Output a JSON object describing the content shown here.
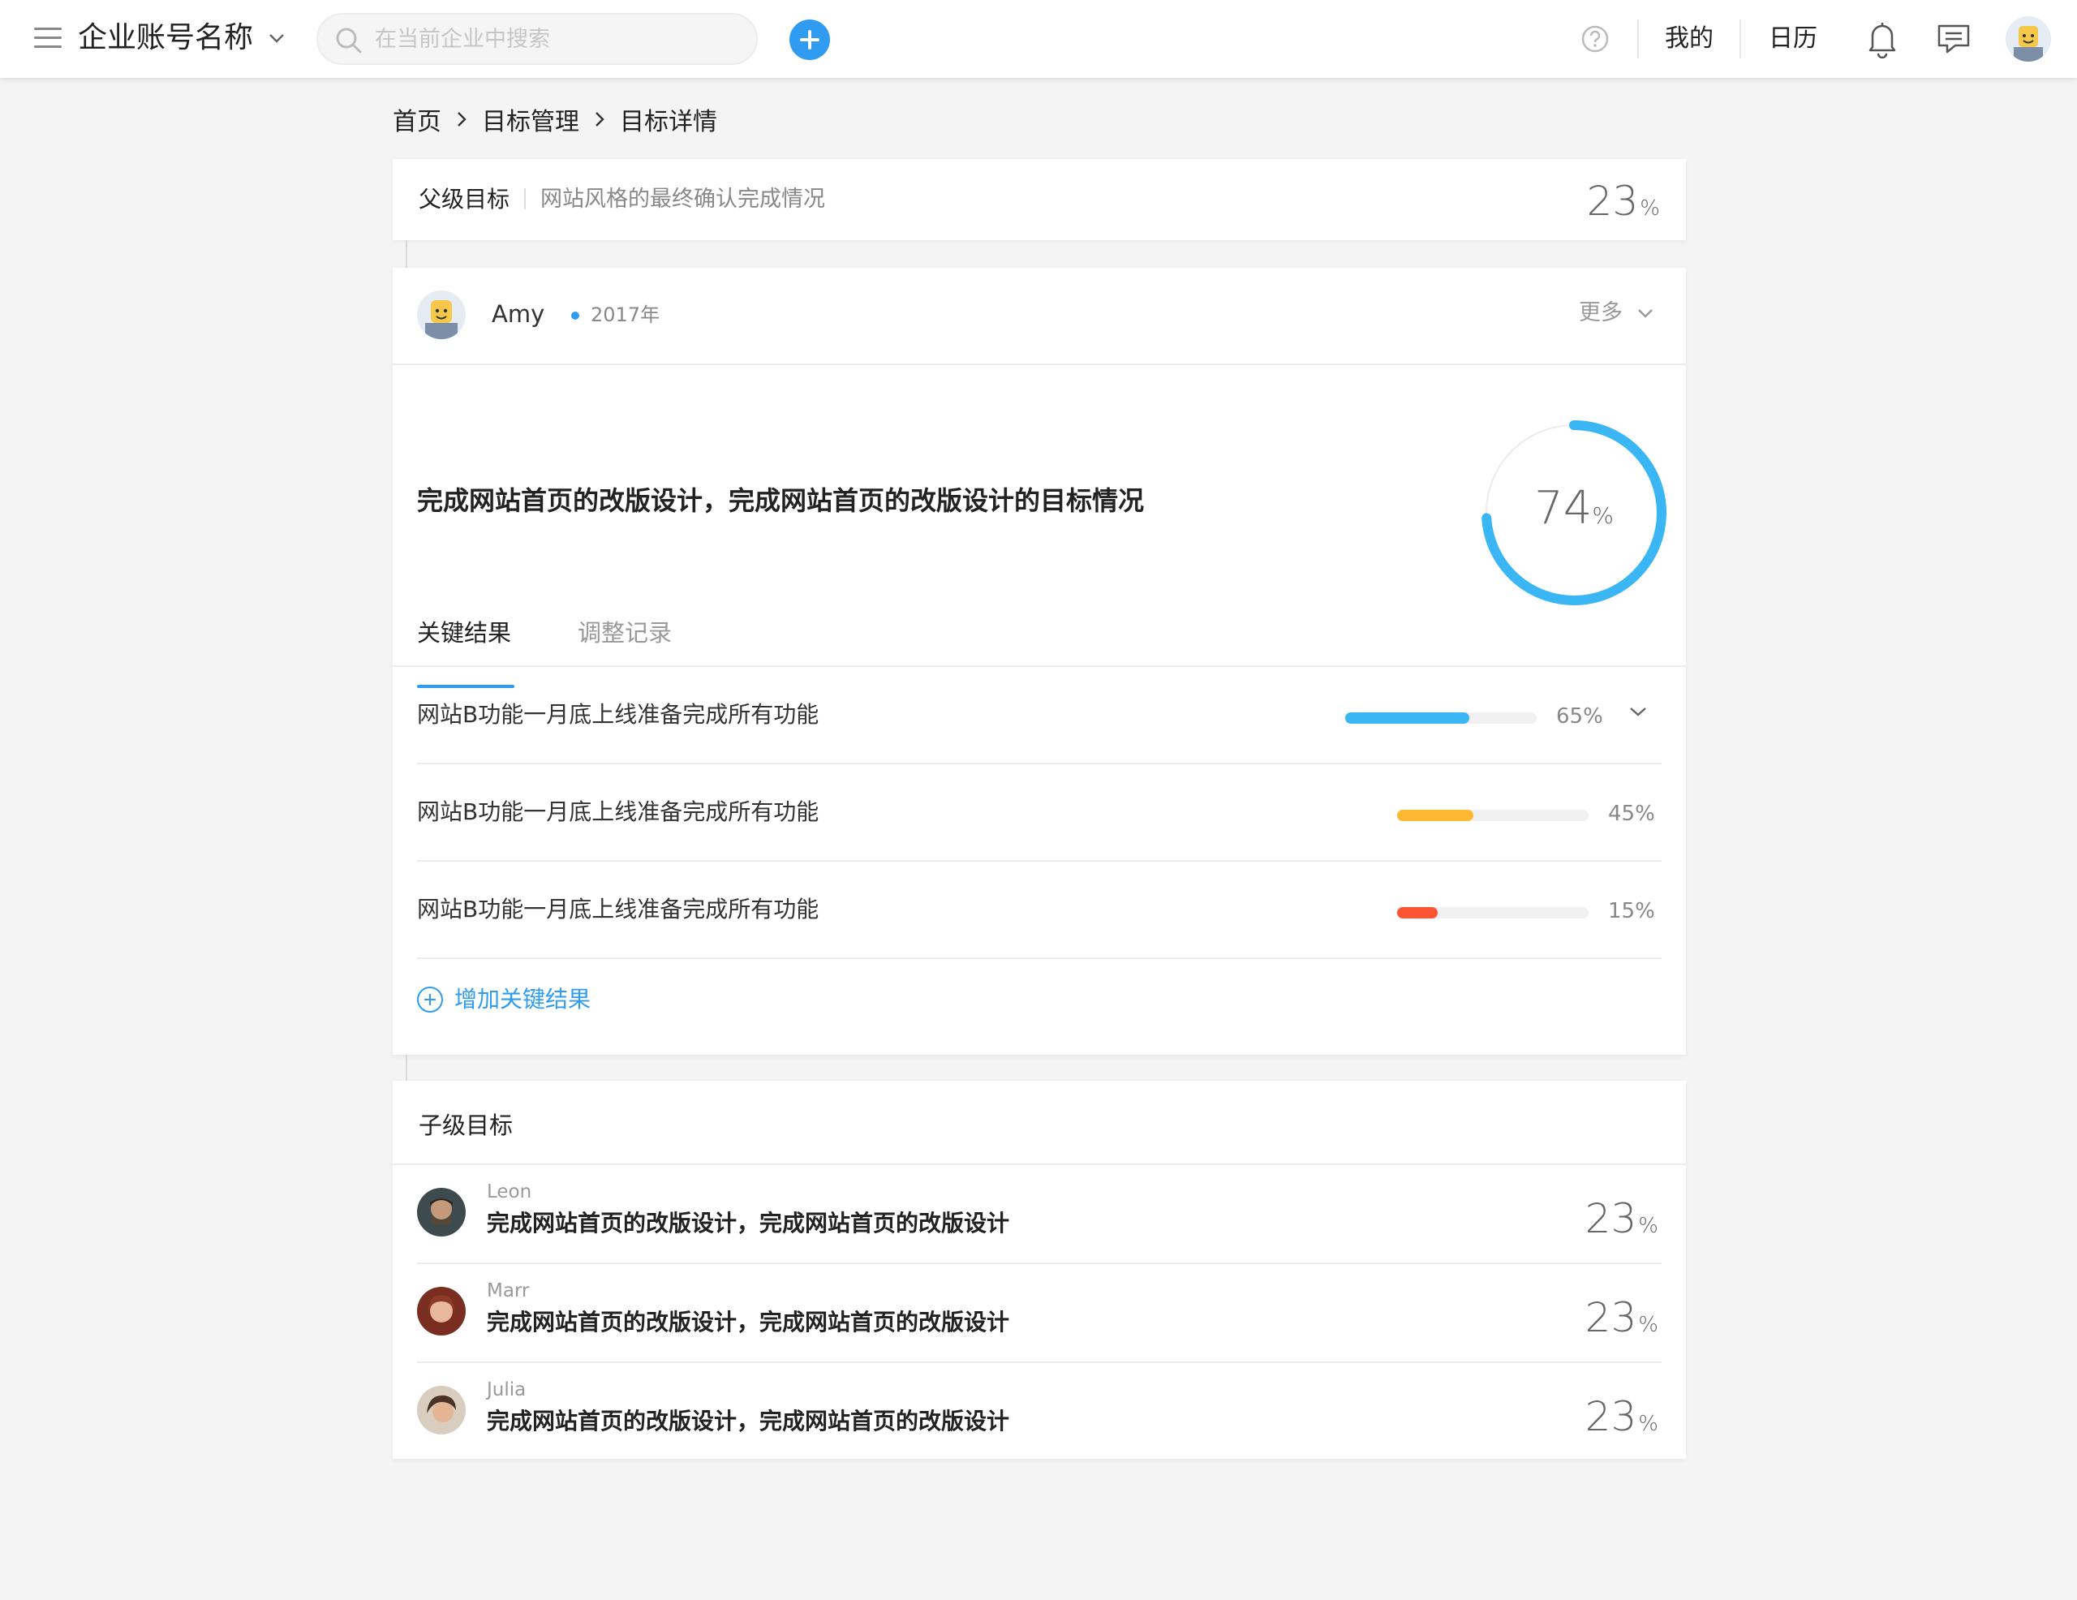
{
  "topbar": {
    "company": "企业账号名称",
    "search_placeholder": "在当前企业中搜索",
    "links": [
      "我的",
      "日历"
    ],
    "colors": {
      "accent": "#2f9cf2"
    }
  },
  "breadcrumb": [
    "首页",
    "目标管理",
    "目标详情"
  ],
  "parent": {
    "label": "父级目标",
    "text": "网站风格的最终确认完成情况",
    "pct": "23",
    "unit": "%"
  },
  "goal": {
    "owner": "Amy",
    "year": "2017年",
    "more": "更多",
    "title": "完成网站首页的改版设计，完成网站首页的改版设计的目标情况",
    "progress": "74",
    "unit": "%",
    "progress_fraction": 0.74
  },
  "tabs": [
    "关键结果",
    "调整记录"
  ],
  "key_results": [
    {
      "text": "网站B功能一月底上线准备完成所有功能",
      "pct": "65%",
      "fraction": 0.65,
      "color": "#3ab6f5",
      "expandable": true
    },
    {
      "text": "网站B功能一月底上线准备完成所有功能",
      "pct": "45%",
      "fraction": 0.4,
      "color": "#fdb931",
      "expandable": false
    },
    {
      "text": "网站B功能一月底上线准备完成所有功能",
      "pct": "15%",
      "fraction": 0.21,
      "color": "#fb5533",
      "expandable": false
    }
  ],
  "add_kr": "增加关键结果",
  "sub_goals": {
    "title": "子级目标",
    "items": [
      {
        "name": "Leon",
        "goal": "完成网站首页的改版设计，完成网站首页的改版设计",
        "pct": "23",
        "unit": "%"
      },
      {
        "name": "Marr",
        "goal": "完成网站首页的改版设计，完成网站首页的改版设计",
        "pct": "23",
        "unit": "%"
      },
      {
        "name": "Julia",
        "goal": "完成网站首页的改版设计，完成网站首页的改版设计",
        "pct": "23",
        "unit": "%"
      }
    ]
  }
}
